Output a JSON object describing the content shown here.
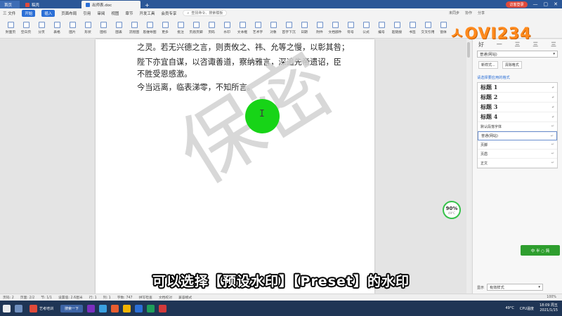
{
  "tabs": {
    "home": "首页",
    "draft": "稿壳",
    "doc": "出师表.doc",
    "add": "+"
  },
  "titlebar": {
    "login": "访客登录"
  },
  "menu": {
    "file": "三 文件",
    "items": [
      "开始",
      "插入",
      "页面布局",
      "引用",
      "审阅",
      "视图",
      "章节",
      "开发工具",
      "会员专享"
    ],
    "active_index": 1,
    "search": "查找命令、搜索模板",
    "right": [
      "未同步",
      "协作",
      "分享"
    ]
  },
  "ribbon": [
    "封面页",
    "空白页",
    "分页",
    "表格",
    "图片",
    "形状",
    "图标",
    "图表",
    "流程图",
    "思维导图",
    "更多",
    "批注",
    "页眉页脚",
    "页码",
    "水印",
    "文本框",
    "艺术字",
    "对象",
    "首字下沉",
    "日期",
    "附件",
    "文档部件",
    "符号",
    "公式",
    "编号",
    "超链接",
    "书签",
    "交叉引用",
    "窗体"
  ],
  "document": {
    "lines": [
      "之灵。若无兴德之言，则责攸之、祎、允等之慢，以彰其咎；",
      "陛下亦宜自谋，以咨诹善道，察纳雅言，深追先帝遗诏，臣",
      "不胜受恩感激。",
      "今当远离，临表涕零，不知所言。"
    ],
    "watermark": "保密"
  },
  "gauge": {
    "value": "90%",
    "temp": "49°C"
  },
  "style_pane": {
    "top": [
      "好",
      "一 ",
      "三",
      "三",
      "三"
    ],
    "current_style": "普通(网站)",
    "new_style": "新样式...",
    "clear_format": "清除格式",
    "apply_label": "请选择要应用的格式",
    "styles": [
      {
        "label": "标题 1",
        "kind": "h"
      },
      {
        "label": "标题 2",
        "kind": "h"
      },
      {
        "label": "标题 3",
        "kind": "h"
      },
      {
        "label": "标题 4",
        "kind": "h"
      },
      {
        "label": "默认段落字体",
        "kind": "s"
      },
      {
        "label": "普通(网站)",
        "kind": "s"
      },
      {
        "label": "页脚",
        "kind": "s"
      },
      {
        "label": "页眉",
        "kind": "s"
      },
      {
        "label": "正文",
        "kind": "s"
      }
    ],
    "show_label": "显示",
    "show_value": "有效样式"
  },
  "badge": "中 半 ○ 简",
  "subtitle": "可以选择【预设水印】【Preset】的水印",
  "statusbar": [
    "页码: 2",
    "页面: 2/2",
    "节: 1/1",
    "设置值: 2.6厘米",
    "行: 1",
    "列: 1",
    "字数: 747",
    "拼写检查",
    "文档校对",
    "兼容模式"
  ],
  "statusbar_zoom": "100%",
  "taskbar": {
    "apps": [
      "艺考培训"
    ],
    "search": "搜索一下",
    "tray": [
      "49°C",
      "CPU温度"
    ],
    "time": "18:09 周五",
    "date": "2021/1/15"
  },
  "brand": "ㅅOVI234",
  "colors": {
    "accent": "#2b5797",
    "cursor": "#17d417",
    "watermark": "#d2d2d2"
  }
}
